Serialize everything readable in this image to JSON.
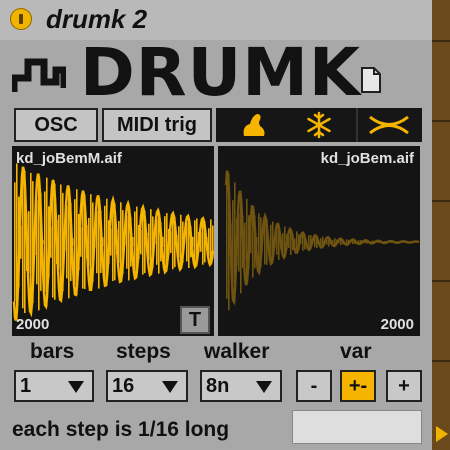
{
  "device": {
    "title": "drumk 2"
  },
  "logo": {
    "text": "DRUMK"
  },
  "buttons": {
    "osc": "OSC",
    "midi_trig": "MIDI trig"
  },
  "icon_bar": {
    "icons": [
      "dinosaur-icon",
      "snowflake-icon",
      "crossfade-icon"
    ]
  },
  "panels": {
    "left": {
      "file": "kd_joBemM.aif",
      "value": "2000",
      "t_label": "T"
    },
    "right": {
      "file": "kd_joBem.aif",
      "value": "2000"
    }
  },
  "controls": {
    "bars": {
      "label": "bars",
      "value": "1"
    },
    "steps": {
      "label": "steps",
      "value": "16"
    },
    "walker": {
      "label": "walker",
      "value": "8n"
    },
    "var": {
      "label": "var",
      "minus": "-",
      "plusminus": "+-",
      "plus": "+"
    }
  },
  "status": {
    "text": "each step is 1/16 long",
    "field_value": ""
  },
  "colors": {
    "accent": "#f5b400",
    "waveform_dim": "#6e5410",
    "panel_bg": "#141414",
    "device_bg": "#a8a8a8"
  }
}
